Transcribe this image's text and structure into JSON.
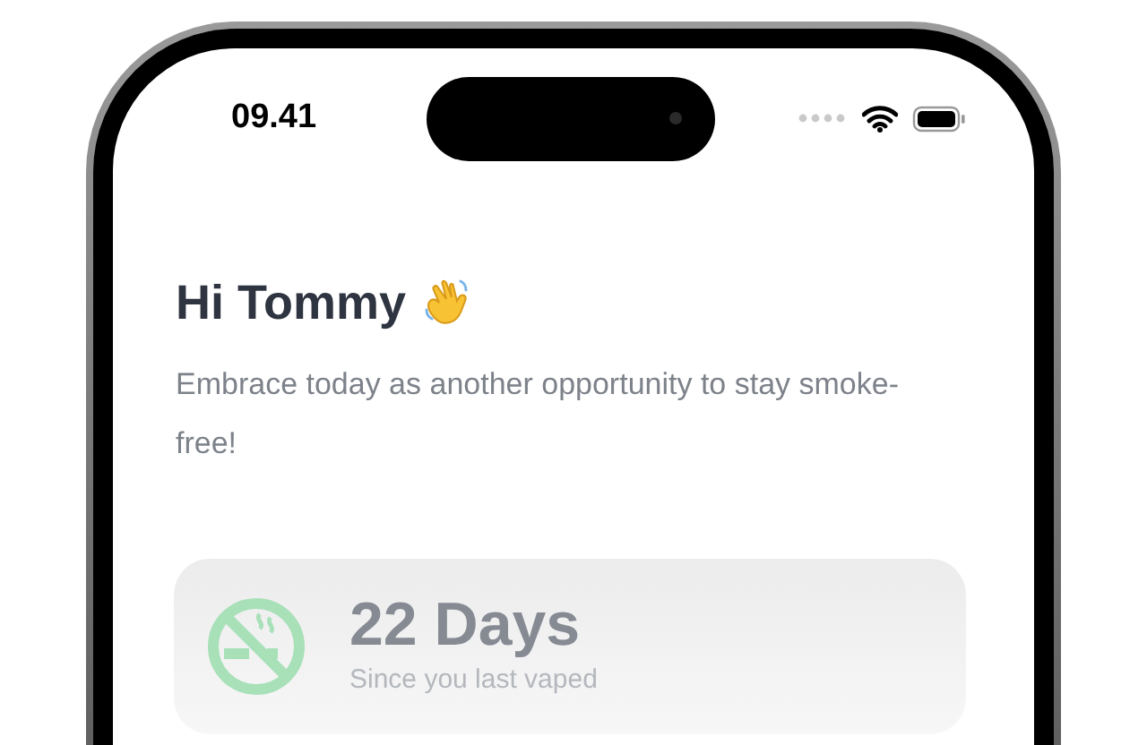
{
  "status_bar": {
    "time": "09.41"
  },
  "greeting": {
    "title": "Hi Tommy",
    "subtitle": "Embrace today as another opportunity to stay smoke-free!"
  },
  "streak_card": {
    "value": "22 Days",
    "caption": "Since you last vaped"
  }
}
